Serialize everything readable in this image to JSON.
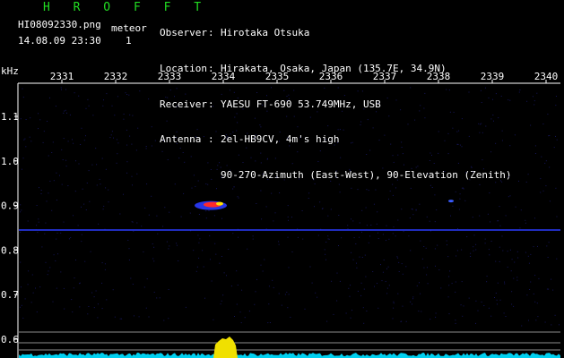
{
  "header": {
    "brand": "H R O F F T",
    "filename": "HI08092330.png",
    "meteor_label": "meteor",
    "datetime": "14.08.09 23:30",
    "meteor_count": "1"
  },
  "info": [
    {
      "key": "Observer",
      "value": "Hirotaka Otsuka"
    },
    {
      "key": "Location",
      "value": "Hirakata, Osaka, Japan (135.7E, 34.9N)"
    },
    {
      "key": "Receiver",
      "value": "YAESU FT-690 53.749MHz, USB"
    },
    {
      "key": "Antenna",
      "value": "2el-HB9CV, 4m's high"
    },
    {
      "key": "",
      "value": "90-270-Azimuth (East-West), 90-Elevation (Zenith)"
    }
  ],
  "chart_data": {
    "type": "heatmap",
    "title": "",
    "xlabel": "",
    "ylabel": "kHz",
    "x_ticks": [
      "2331",
      "2332",
      "2333",
      "2334",
      "2335",
      "2336",
      "2337",
      "2338",
      "2339",
      "2340"
    ],
    "y_ticks": [
      "1.1",
      "1.0",
      "0.9",
      "0.8",
      "0.7",
      "0.6"
    ],
    "carrier_khz": 0.845,
    "meteor_echo": {
      "khz": 0.9,
      "minute_position": 2334
    }
  },
  "colors": {
    "background": "#000000",
    "brand": "#22dd22",
    "text": "#ffffff",
    "carrier": "#2a3cff",
    "noise": "#1a1a6a",
    "level": "#00d0f0",
    "level_peak": "#f0e000"
  }
}
